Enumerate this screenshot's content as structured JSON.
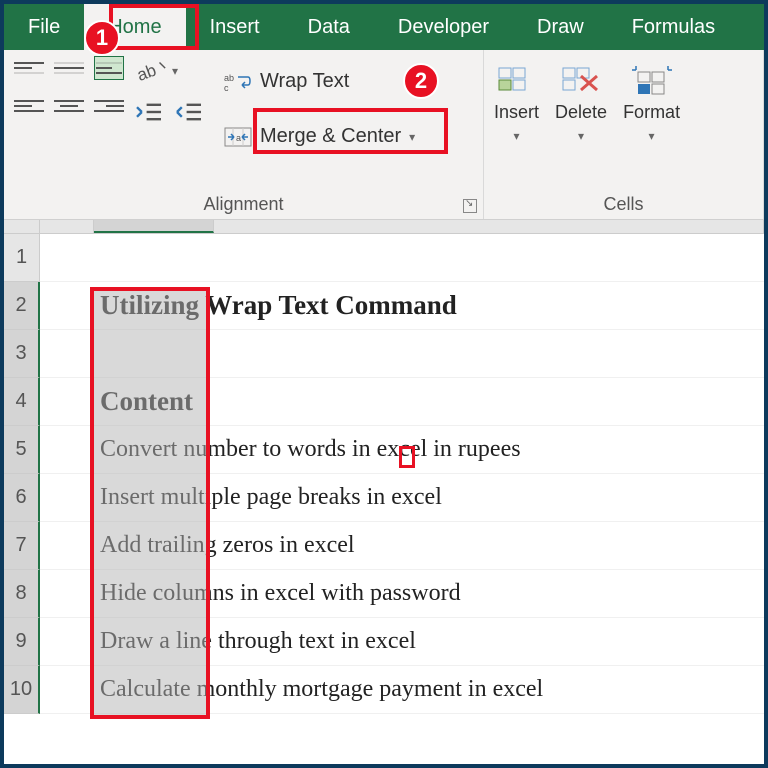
{
  "tabs": {
    "file": "File",
    "home": "Home",
    "insert": "Insert",
    "data": "Data",
    "developer": "Developer",
    "draw": "Draw",
    "formulas": "Formulas"
  },
  "ribbon": {
    "wrap_text": "Wrap Text",
    "merge_center": "Merge & Center",
    "alignment_label": "Alignment",
    "insert": "Insert",
    "delete": "Delete",
    "format": "Format",
    "cells_label": "Cells"
  },
  "callouts": {
    "one": "1",
    "two": "2"
  },
  "rows": {
    "headers": [
      "1",
      "2",
      "3",
      "4",
      "5",
      "6",
      "7",
      "8",
      "9",
      "10"
    ],
    "data": [
      "",
      "Utilizing Wrap Text Command",
      "",
      "Content",
      "Convert number to words in excel in rupees",
      "Insert multiple page breaks in excel",
      "Add trailing zeros in excel",
      "Hide columns in excel with password",
      "Draw a line through text in excel",
      "Calculate monthly mortgage payment in excel"
    ]
  }
}
